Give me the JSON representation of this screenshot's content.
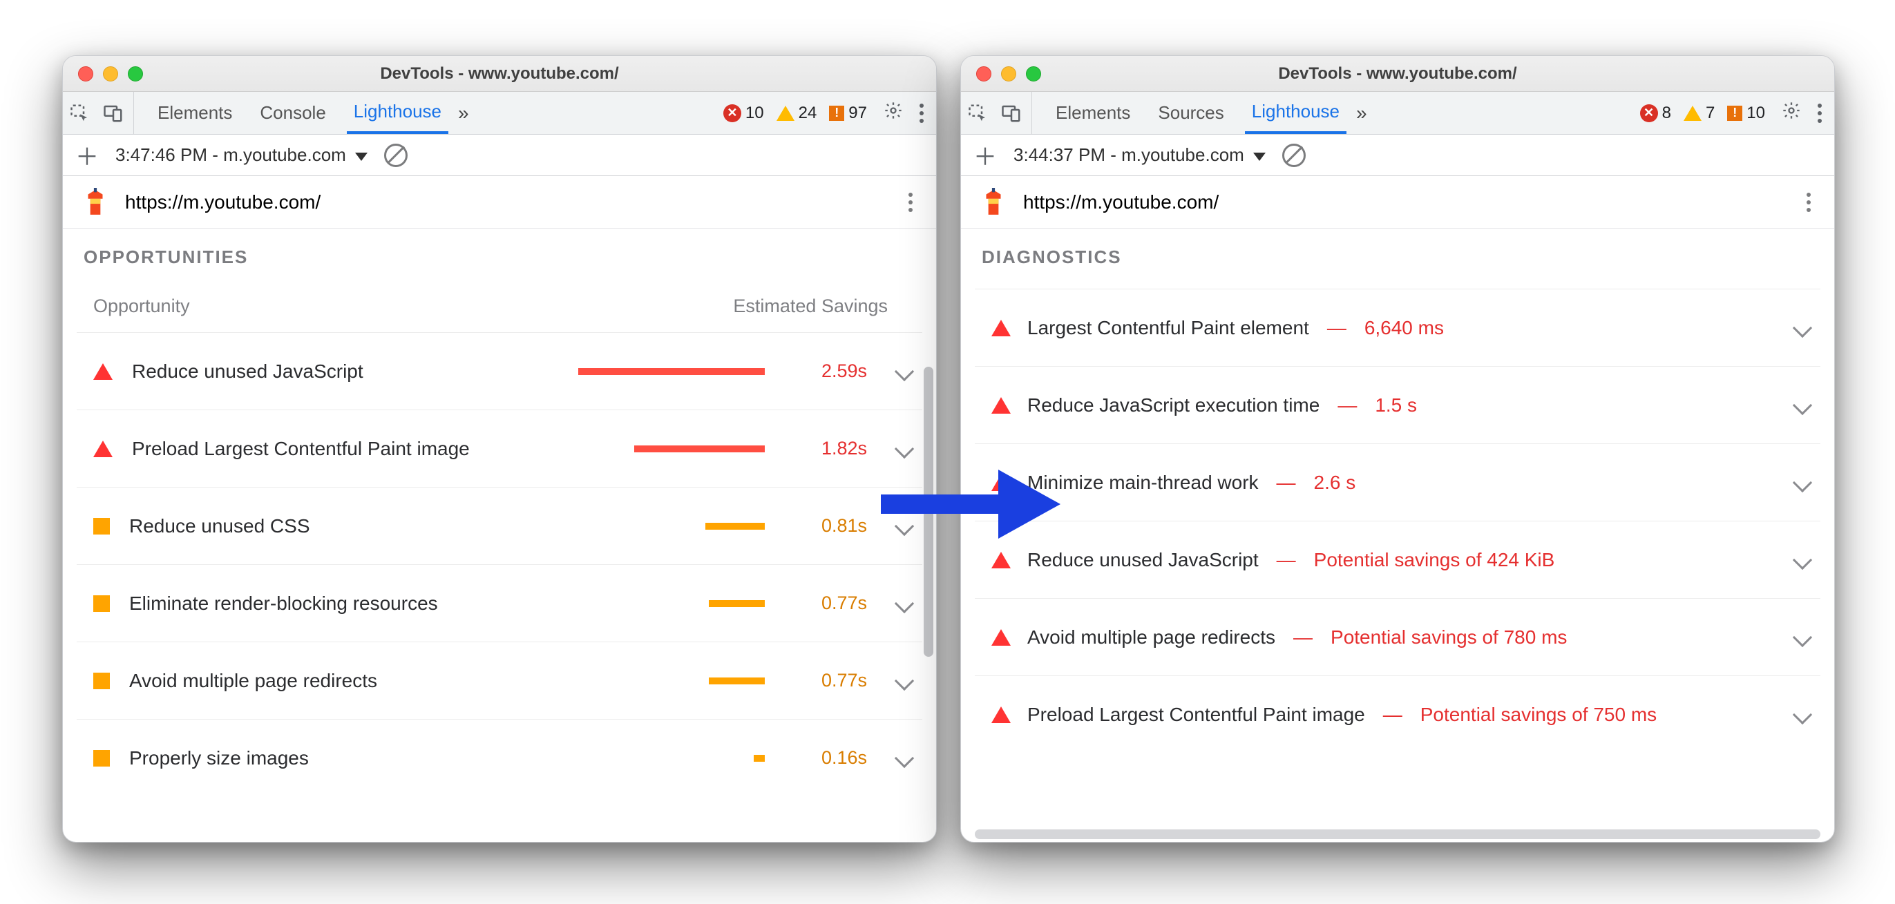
{
  "left": {
    "window_title": "DevTools - www.youtube.com/",
    "tabs": [
      "Elements",
      "Console",
      "Lighthouse"
    ],
    "active_tab_index": 2,
    "issues": {
      "errors": 10,
      "warnings": 24,
      "info": 97
    },
    "timestamp": "3:47:46 PM - m.youtube.com",
    "url": "https://m.youtube.com/",
    "section_title": "OPPORTUNITIES",
    "col_left": "Opportunity",
    "col_right": "Estimated Savings",
    "audits": [
      {
        "sev": "tri",
        "title": "Reduce unused JavaScript",
        "bar_color": "red",
        "bar_pct": 100,
        "savings": "2.59s",
        "sav_class": "red"
      },
      {
        "sev": "tri",
        "title": "Preload Largest Contentful Paint image",
        "bar_color": "red",
        "bar_pct": 70,
        "savings": "1.82s",
        "sav_class": "red"
      },
      {
        "sev": "sq",
        "title": "Reduce unused CSS",
        "bar_color": "amber",
        "bar_pct": 32,
        "savings": "0.81s",
        "sav_class": "amber"
      },
      {
        "sev": "sq",
        "title": "Eliminate render-blocking resources",
        "bar_color": "amber",
        "bar_pct": 30,
        "savings": "0.77s",
        "sav_class": "amber"
      },
      {
        "sev": "sq",
        "title": "Avoid multiple page redirects",
        "bar_color": "amber",
        "bar_pct": 30,
        "savings": "0.77s",
        "sav_class": "amber"
      },
      {
        "sev": "sq",
        "title": "Properly size images",
        "bar_color": "amber",
        "bar_pct": 6,
        "savings": "0.16s",
        "sav_class": "amber"
      }
    ]
  },
  "right": {
    "window_title": "DevTools - www.youtube.com/",
    "tabs": [
      "Elements",
      "Sources",
      "Lighthouse"
    ],
    "active_tab_index": 2,
    "issues": {
      "errors": 8,
      "warnings": 7,
      "info": 10
    },
    "timestamp": "3:44:37 PM - m.youtube.com",
    "url": "https://m.youtube.com/",
    "section_title": "DIAGNOSTICS",
    "diags": [
      {
        "title": "Largest Contentful Paint element",
        "value": "6,640 ms"
      },
      {
        "title": "Reduce JavaScript execution time",
        "value": "1.5 s"
      },
      {
        "title": "Minimize main-thread work",
        "value": "2.6 s"
      },
      {
        "title": "Reduce unused JavaScript",
        "value": "Potential savings of 424 KiB"
      },
      {
        "title": "Avoid multiple page redirects",
        "value": "Potential savings of 780 ms"
      },
      {
        "title": "Preload Largest Contentful Paint image",
        "value": "Potential savings of 750 ms"
      }
    ]
  }
}
